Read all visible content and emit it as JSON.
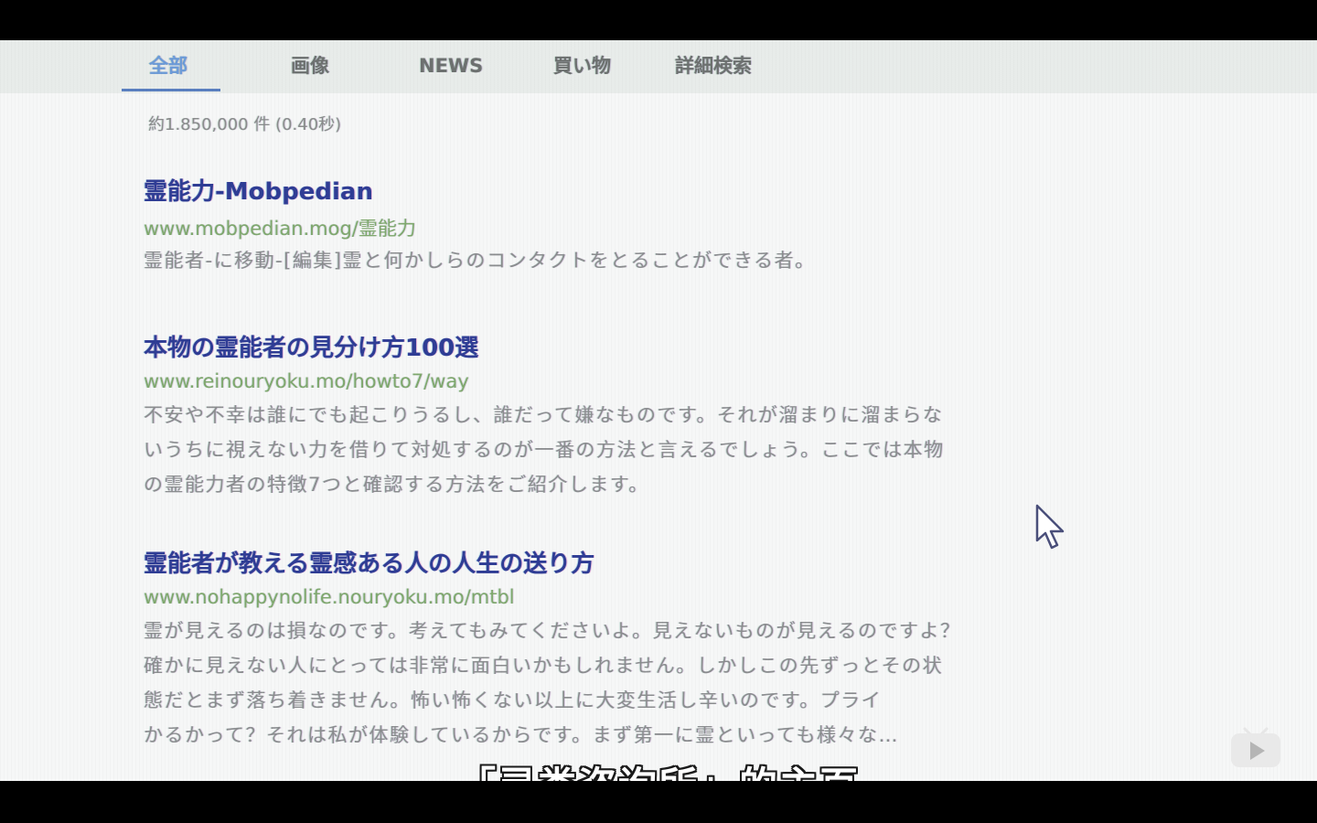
{
  "tabs": [
    {
      "label": "全部",
      "active": true
    },
    {
      "label": "画像",
      "active": false
    },
    {
      "label": "NEWS",
      "active": false
    },
    {
      "label": "買い物",
      "active": false
    },
    {
      "label": "詳細検索",
      "active": false
    }
  ],
  "result_count": "約1.850,000 件 (0.40秒)",
  "results": [
    {
      "title": "霊能力-Mobpedian",
      "url": "www.mobpedian.mog/霊能力",
      "snippet": "霊能者-に移動-[編集]霊と何かしらのコンタクトをとることができる者。"
    },
    {
      "title": "本物の霊能者の見分け方100選",
      "url": "www.reinouryoku.mo/howto7/way",
      "snippet": "不安や不幸は誰にでも起こりうるし、誰だって嫌なものです。それが溜まりに溜まらないうちに視えない力を借りて対処するのが一番の方法と言えるでしょう。ここでは本物の霊能力者の特徴7つと確認する方法をご紹介します。"
    },
    {
      "title": "霊能者が教える霊感ある人の人生の送り方",
      "url": "www.nohappynolife.nouryoku.mo/mtbl",
      "snippet": "霊が見えるのは損なのです。考えてもみてくださいよ。見えないものが見えるのですよ？確かに見えない人にとっては非常に面白いかもしれません。しかしこの先ずっとその状態だとまず落ち着きません。怖い怖くない以上に大変生活し辛いのです。プライ　　　　　　　　　　　　　　　かるかって？それは私が体験しているからです。まず第一に霊といっても様々な…"
    }
  ],
  "subtitle": "「灵类咨询所」的主页",
  "colors": {
    "active_tab": "#6c9bd8",
    "title_link": "#2f3d95",
    "url_green": "#7fa86d",
    "snippet_gray": "#8b8d8f",
    "letterbox": "#000000"
  },
  "icons": {
    "cursor": "mouse-pointer-icon",
    "player": "play-button-icon"
  }
}
